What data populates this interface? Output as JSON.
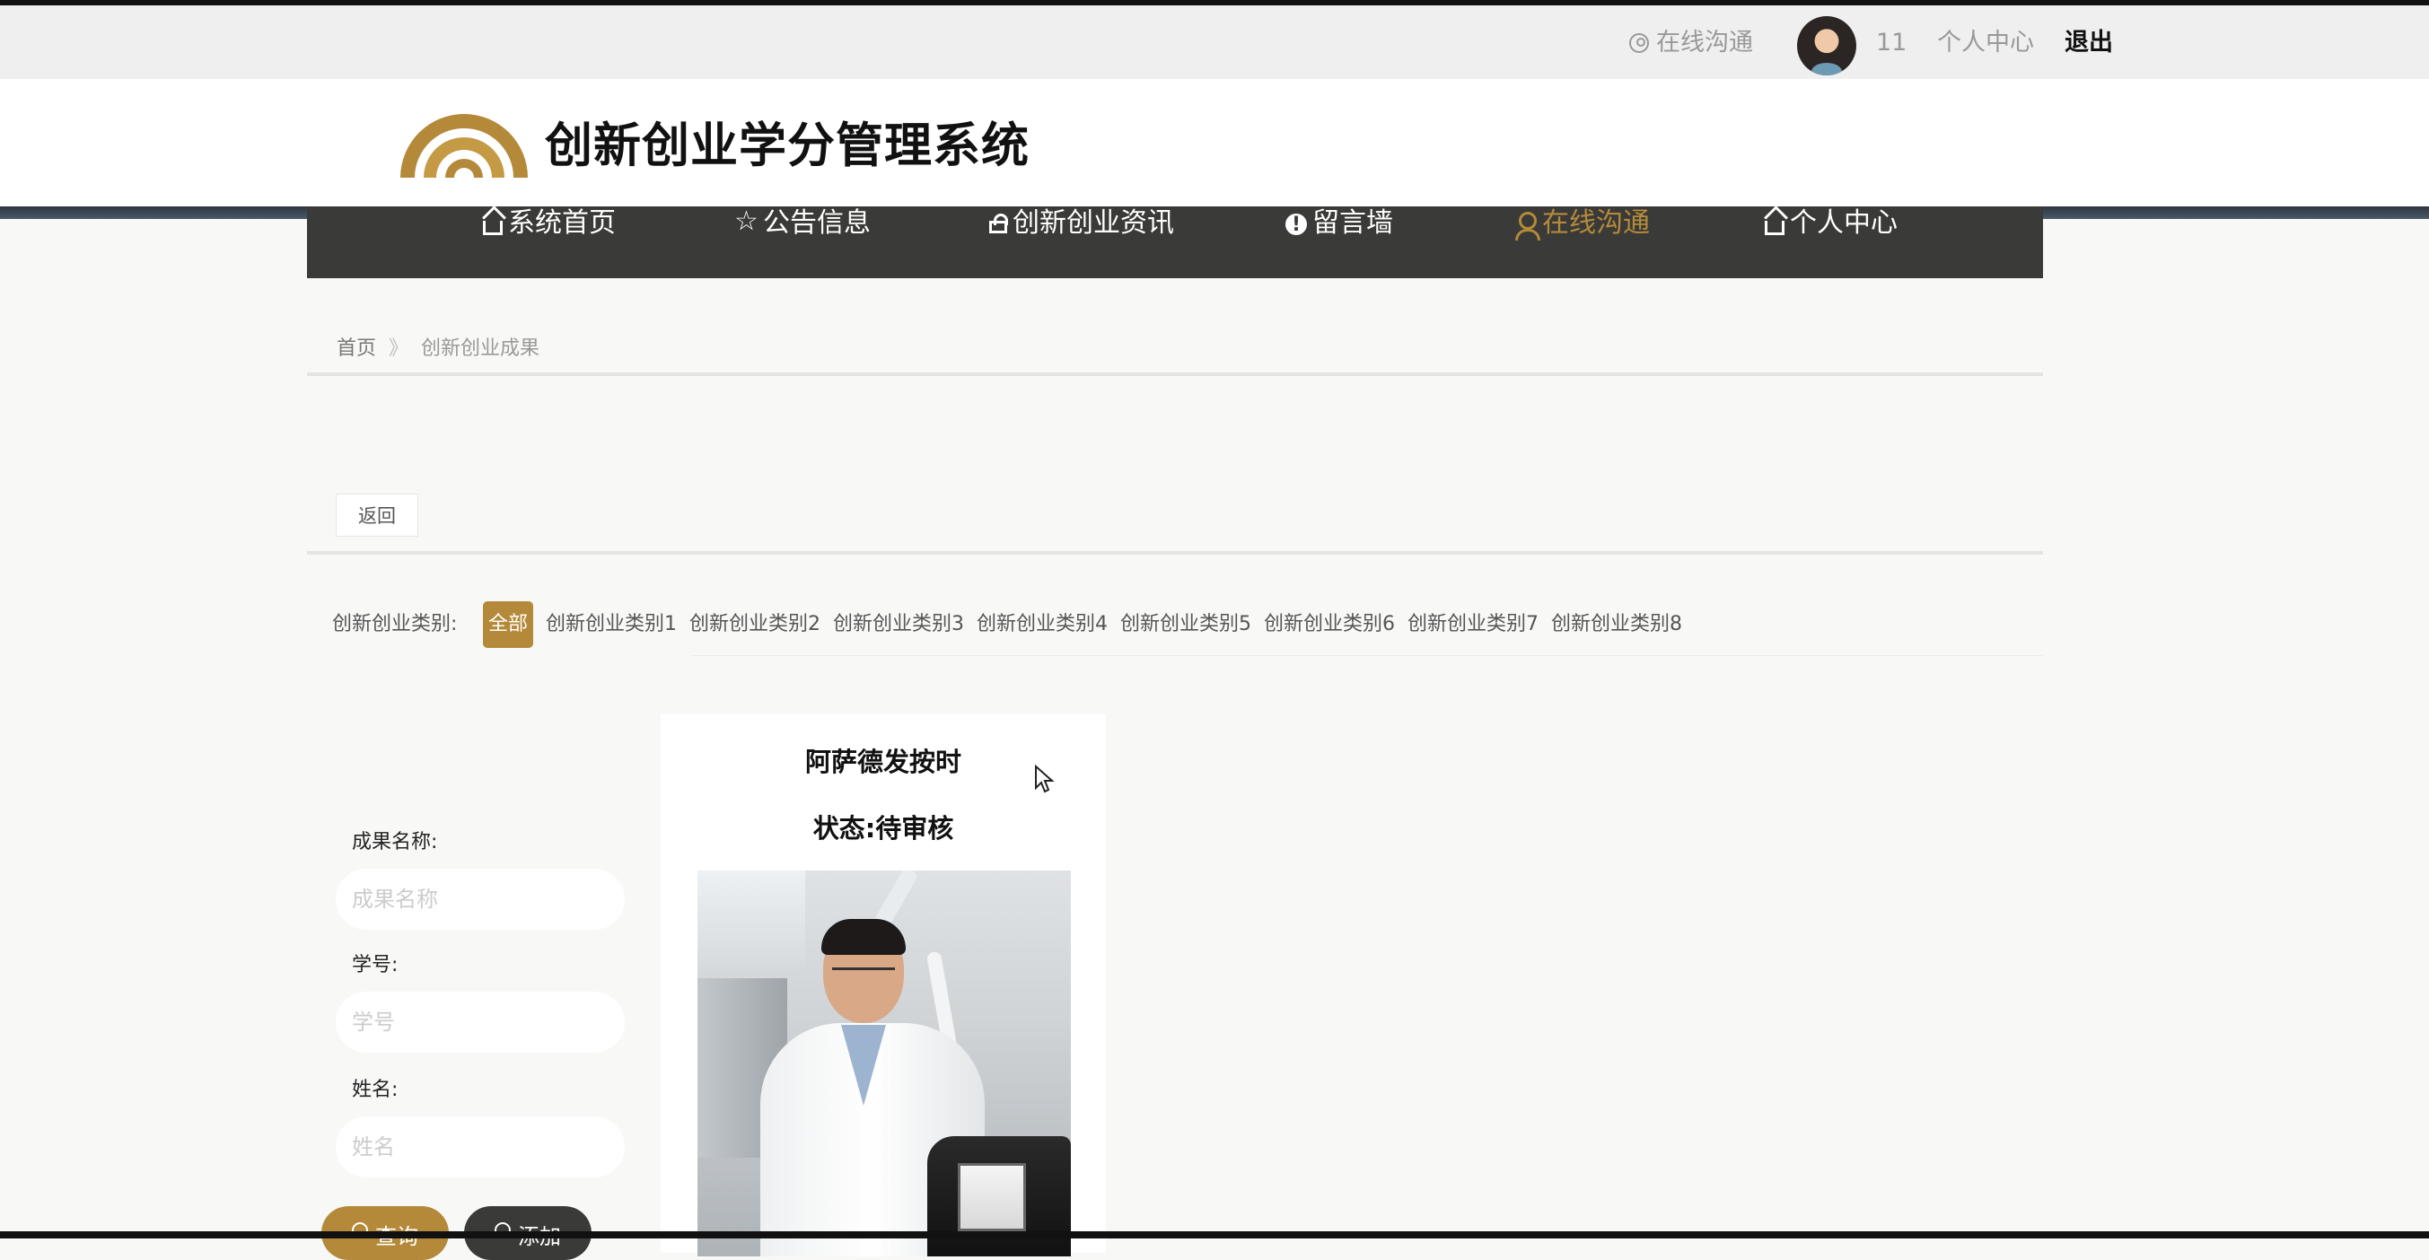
{
  "topbar": {
    "chat_label": "在线沟通",
    "username": "11",
    "center_label": "个人中心",
    "logout_label": "退出"
  },
  "header": {
    "site_title": "创新创业学分管理系统",
    "brand_color": "#b48a3a"
  },
  "nav": {
    "items": [
      {
        "label": "系统首页",
        "icon": "home-icon"
      },
      {
        "label": "公告信息",
        "icon": "star-icon"
      },
      {
        "label": "创新创业资讯",
        "icon": "lock-icon"
      },
      {
        "label": "留言墙",
        "icon": "alert-icon"
      },
      {
        "label": "在线沟通",
        "icon": "user-icon",
        "active": true
      },
      {
        "label": "个人中心",
        "icon": "home-icon"
      }
    ]
  },
  "breadcrumb": {
    "home": "首页",
    "separator": "》",
    "current": "创新创业成果"
  },
  "back_label": "返回",
  "categories": {
    "label": "创新创业类别:",
    "items": [
      "全部",
      "创新创业类别1",
      "创新创业类别2",
      "创新创业类别3",
      "创新创业类别4",
      "创新创业类别5",
      "创新创业类别6",
      "创新创业类别7",
      "创新创业类别8"
    ],
    "active": "全部"
  },
  "search": {
    "name_label": "成果名称:",
    "name_placeholder": "成果名称",
    "id_label": "学号:",
    "id_placeholder": "学号",
    "person_label": "姓名:",
    "person_placeholder": "姓名",
    "search_label": "查询",
    "add_label": "添加"
  },
  "card": {
    "title": "阿萨德发按时",
    "status": "状态:待审核"
  }
}
